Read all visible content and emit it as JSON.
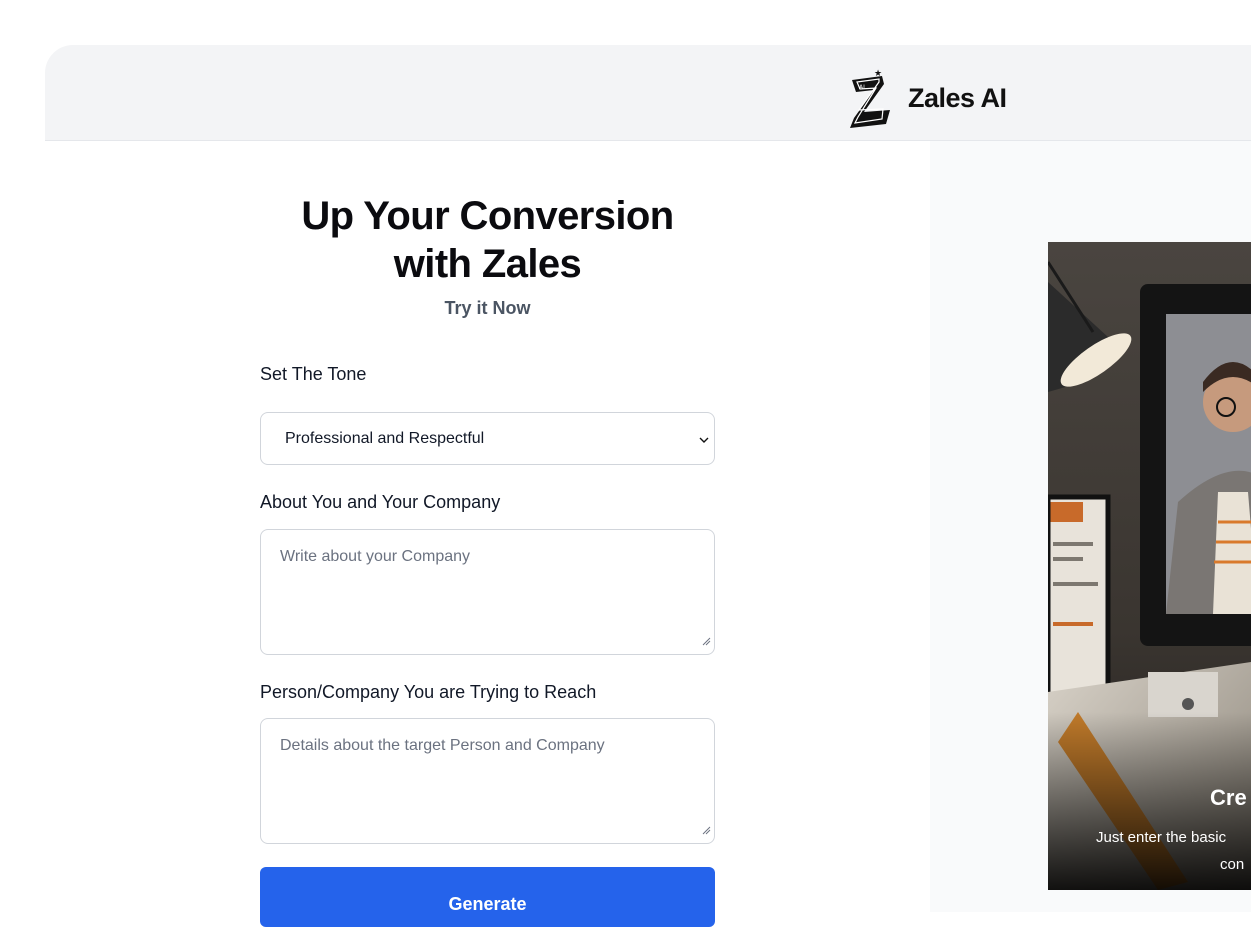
{
  "brand": {
    "name": "Zales AI"
  },
  "hero": {
    "title_line1": "Up Your Conversion",
    "title_line2": "with Zales",
    "subtitle": "Try it Now"
  },
  "form": {
    "tone_label": "Set The Tone",
    "tone_value": "Professional and Respectful",
    "about_label": "About You and Your Company",
    "about_placeholder": "Write about your Company",
    "target_label": "Person/Company You are Trying to Reach",
    "target_placeholder": "Details about the target Person and Company",
    "generate_label": "Generate"
  },
  "card": {
    "title_partial": "Cre",
    "text_line1": "Just enter the basic",
    "text_line2": "con"
  },
  "colors": {
    "primary": "#2563eb",
    "header_bg": "#f3f4f6",
    "panel_bg": "#f9fafb"
  }
}
